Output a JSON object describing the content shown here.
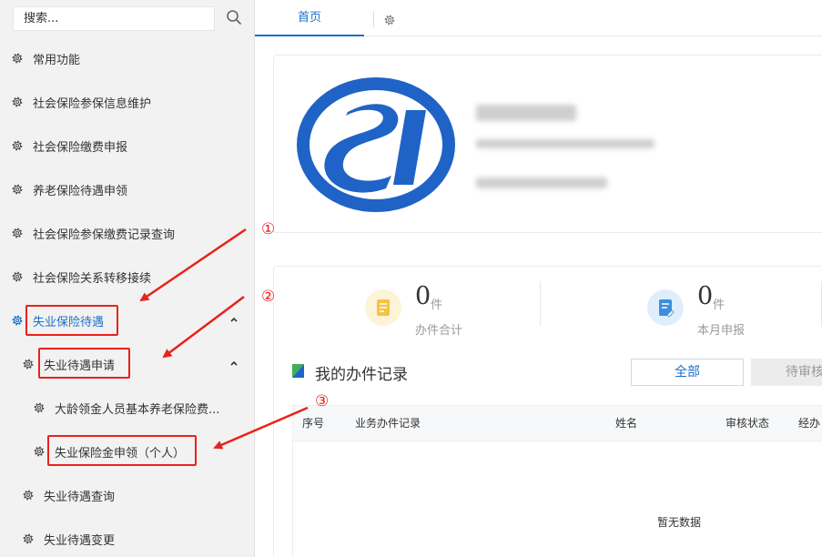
{
  "sidebar": {
    "search": {
      "placeholder": "搜索...",
      "value": ""
    },
    "items": [
      {
        "label": "常用功能"
      },
      {
        "label": "社会保险参保信息维护"
      },
      {
        "label": "社会保险缴费申报"
      },
      {
        "label": "养老保险待遇申领"
      },
      {
        "label": "社会保险参保缴费记录查询"
      },
      {
        "label": "社会保险关系转移接续"
      },
      {
        "label": "失业保险待遇",
        "expanded": true
      },
      {
        "label": "失业待遇申请",
        "expanded": true
      },
      {
        "label": "大龄领金人员基本养老保险费..."
      },
      {
        "label": "失业保险金申领（个人）"
      },
      {
        "label": "失业待遇查询"
      },
      {
        "label": "失业待遇变更"
      }
    ]
  },
  "tabs": [
    {
      "label": "首页",
      "active": true
    }
  ],
  "stats": [
    {
      "value": "0",
      "unit": "件",
      "label": "办件合计",
      "icon": "document-icon",
      "color": "#f5c343"
    },
    {
      "value": "0",
      "unit": "件",
      "label": "本月申报",
      "icon": "edit-document-icon",
      "color": "#3b8fe0"
    }
  ],
  "records": {
    "title": "我的办件记录",
    "filters": [
      {
        "label": "全部",
        "active": true
      },
      {
        "label": "待审核",
        "active": false
      }
    ],
    "columns": [
      "序号",
      "业务办件记录",
      "姓名",
      "审核状态",
      "经办"
    ],
    "empty_text": "暂无数据"
  },
  "annotations": [
    "①",
    "②",
    "③"
  ],
  "colors": {
    "accent": "#1a6fc9",
    "annotation": "#e8221b",
    "logo": "#1f63c6"
  }
}
